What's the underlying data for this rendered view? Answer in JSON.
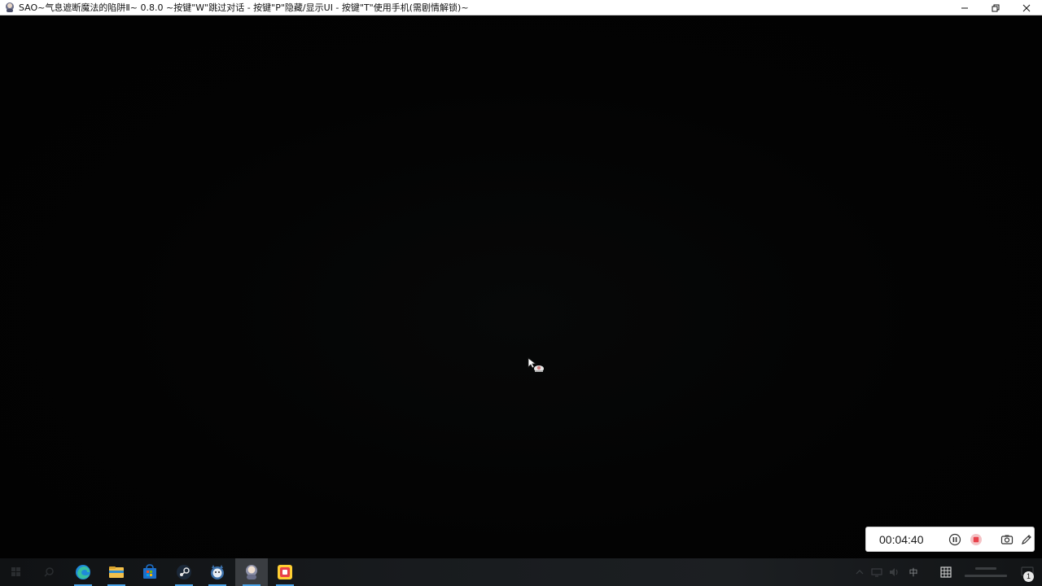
{
  "window": {
    "title": "SAO~气息遮断魔法的陷阱Ⅱ~ 0.8.0 ~按键\"W\"跳过对话 - 按键\"P\"隐藏/显示UI - 按键\"T\"使用手机(需剧情解锁)~",
    "icon": "game-app-icon",
    "controls": [
      "minimize-icon",
      "restore-icon",
      "close-icon"
    ]
  },
  "recorder": {
    "elapsed": "00:04:40",
    "buttons": [
      "pause-icon",
      "stop-icon",
      "camera-icon",
      "pen-icon"
    ],
    "stop_color": "#e8414b"
  },
  "taskbar": {
    "pinned": [
      "start-icon",
      "search-icon",
      "edge-icon",
      "file-explorer-icon",
      "store-icon",
      "steam-icon",
      "app-icon",
      "game-window-icon",
      "app-icon"
    ],
    "active_index": 7,
    "accent": "#4aa3e8"
  },
  "tray": {
    "ime": "中",
    "notification_count": "1"
  }
}
